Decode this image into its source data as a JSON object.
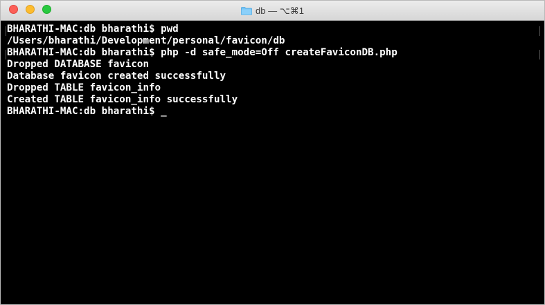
{
  "window": {
    "title": "db — ⌥⌘1",
    "folder_icon": "folder-icon",
    "traffic_lights": {
      "close_color": "#fc5f57",
      "minimize_color": "#fdbc2e",
      "maximize_color": "#28c940"
    }
  },
  "terminal": {
    "background": "#000000",
    "foreground": "#ffffff",
    "lines": [
      "BHARATHI-MAC:db bharathi$ pwd",
      "/Users/bharathi/Development/personal/favicon/db",
      "BHARATHI-MAC:db bharathi$ php -d safe_mode=Off createFaviconDB.php",
      "Dropped DATABASE favicon",
      "Database favicon created successfully",
      "Dropped TABLE favicon_info",
      "Created TABLE favicon_info successfully",
      "BHARATHI-MAC:db bharathi$ _"
    ]
  }
}
